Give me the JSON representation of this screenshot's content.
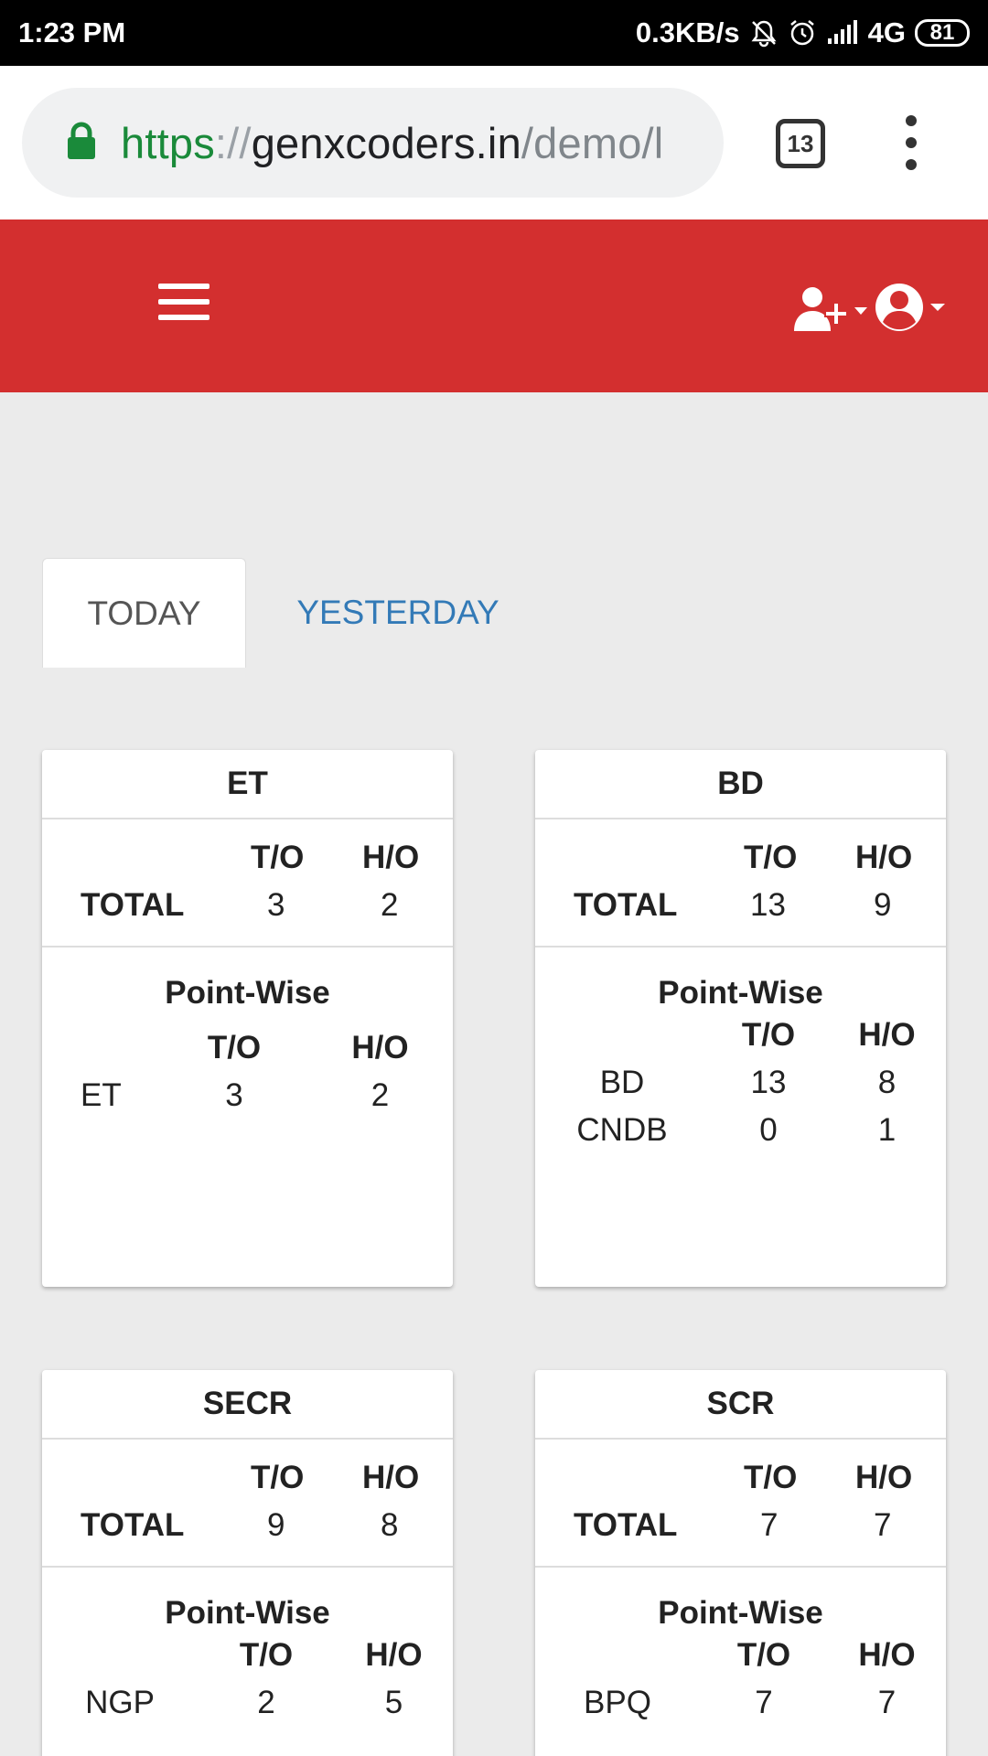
{
  "status_bar": {
    "time": "1:23 PM",
    "speed": "0.3KB/s",
    "network": "4G",
    "battery": "81"
  },
  "browser": {
    "url_scheme": "https",
    "url_sep": "://",
    "url_host": "genxcoders.in",
    "url_path": "/demo/l",
    "tab_count": "13"
  },
  "tabs": [
    {
      "label": "TODAY",
      "active": true
    },
    {
      "label": "YESTERDAY",
      "active": false
    }
  ],
  "col_to": "T/O",
  "col_ho": "H/O",
  "total_label": "TOTAL",
  "pointwise_label": "Point-Wise",
  "cards": [
    {
      "title": "ET",
      "total_to": "3",
      "total_ho": "2",
      "rows": [
        {
          "name": "ET",
          "to": "3",
          "ho": "2"
        }
      ]
    },
    {
      "title": "BD",
      "total_to": "13",
      "total_ho": "9",
      "rows": [
        {
          "name": "BD",
          "to": "13",
          "ho": "8"
        },
        {
          "name": "CNDB",
          "to": "0",
          "ho": "1"
        }
      ]
    },
    {
      "title": "SECR",
      "total_to": "9",
      "total_ho": "8",
      "rows": [
        {
          "name": "NGP",
          "to": "2",
          "ho": "5"
        }
      ]
    },
    {
      "title": "SCR",
      "total_to": "7",
      "total_ho": "7",
      "rows": [
        {
          "name": "BPQ",
          "to": "7",
          "ho": "7"
        }
      ]
    }
  ],
  "colors": {
    "header": "#d32f2f",
    "link": "#337ab7",
    "lock": "#1a8a3a"
  }
}
